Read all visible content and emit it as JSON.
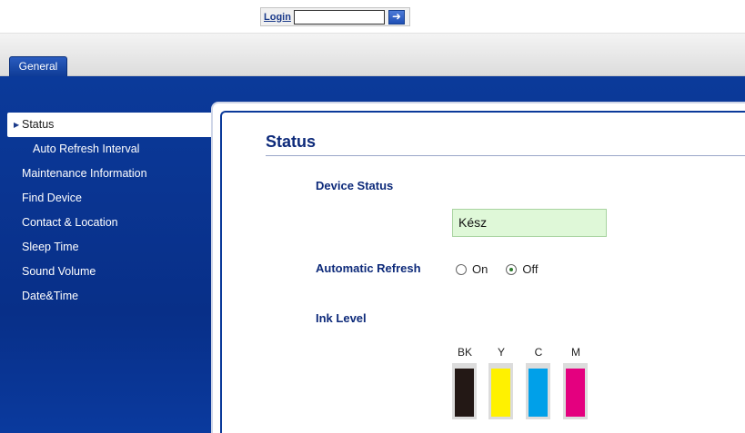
{
  "header": {
    "login_label": "Login",
    "login_value": "",
    "go_icon": "arrow-right-icon"
  },
  "tabs": [
    {
      "label": "General",
      "active": true
    }
  ],
  "sidebar": {
    "items": [
      {
        "label": "Status",
        "active": true
      },
      {
        "label": "Auto Refresh Interval",
        "sub": true
      },
      {
        "label": "Maintenance Information"
      },
      {
        "label": "Find Device"
      },
      {
        "label": "Contact & Location"
      },
      {
        "label": "Sleep Time"
      },
      {
        "label": "Sound Volume"
      },
      {
        "label": "Date&Time"
      }
    ]
  },
  "main": {
    "title": "Status",
    "device_status": {
      "label": "Device Status",
      "value": "Kész"
    },
    "auto_refresh": {
      "label": "Automatic Refresh",
      "options": [
        {
          "label": "On",
          "checked": false
        },
        {
          "label": "Off",
          "checked": true
        }
      ]
    },
    "ink_level": {
      "label": "Ink Level",
      "inks": [
        {
          "label": "BK",
          "color": "#231815"
        },
        {
          "label": "Y",
          "color": "#fff100"
        },
        {
          "label": "C",
          "color": "#00a0e9"
        },
        {
          "label": "M",
          "color": "#e4007f"
        }
      ]
    }
  }
}
